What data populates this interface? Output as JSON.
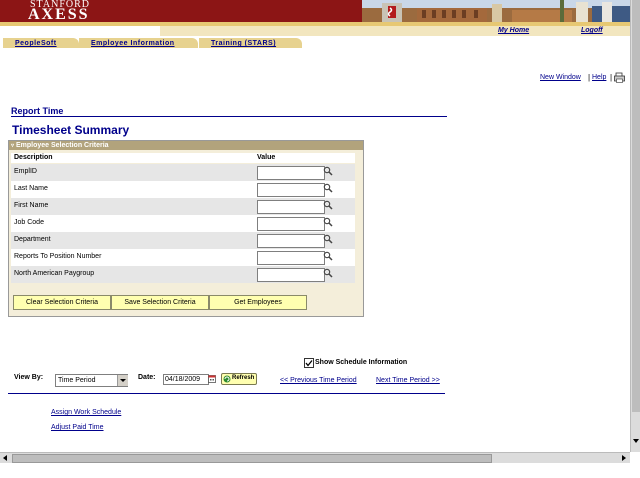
{
  "header": {
    "logo_top": "STANFORD",
    "logo_bottom": "AXESS",
    "my_home": "My Home",
    "logoff": "Logoff",
    "colors": {
      "cardinal": "#8c1515",
      "gold": "#e7c873",
      "link": "#00008b"
    }
  },
  "tabs": [
    {
      "label": "PeopleSoft"
    },
    {
      "label": "Employee Information"
    },
    {
      "label": "Training (STARS)"
    }
  ],
  "utility": {
    "new_window": "New Window",
    "help": "Help",
    "sep": "|",
    "print_icon_text": "Print"
  },
  "page": {
    "label": "Report Time",
    "title": "Timesheet Summary"
  },
  "criteria": {
    "header": "Employee Selection Criteria",
    "col_description": "Description",
    "col_value": "Value",
    "rows": [
      {
        "label": "EmplID",
        "value": ""
      },
      {
        "label": "Last Name",
        "value": ""
      },
      {
        "label": "First Name",
        "value": ""
      },
      {
        "label": "Job Code",
        "value": ""
      },
      {
        "label": "Department",
        "value": ""
      },
      {
        "label": "Reports To Position Number",
        "value": ""
      },
      {
        "label": "North American Paygroup",
        "value": ""
      }
    ],
    "buttons": {
      "clear": "Clear Selection Criteria",
      "save": "Save Selection Criteria",
      "get": "Get Employees"
    }
  },
  "view": {
    "show_schedule_label": "Show Schedule Information",
    "show_schedule_checked": true,
    "view_by_label": "View By:",
    "view_by_value": "Time Period",
    "date_label": "Date:",
    "date_value": "04/18/2009",
    "refresh_label": "Refresh",
    "prev": "<< Previous Time Period",
    "next": "Next Time Period >>"
  },
  "links": {
    "assign_schedule": "Assign Work Schedule",
    "adjust_paid_time": "Adjust Paid Time"
  }
}
